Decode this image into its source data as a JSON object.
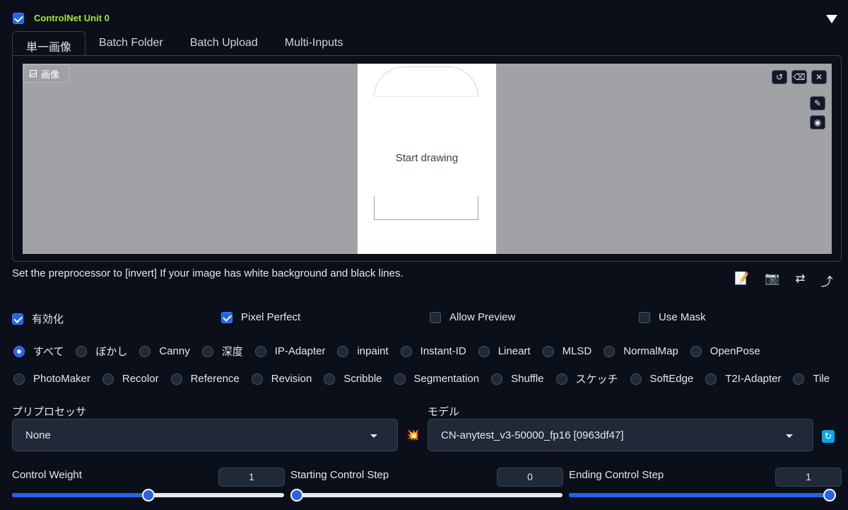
{
  "unit": {
    "title": "ControlNet Unit 0",
    "checked": true
  },
  "tabs": [
    {
      "label": "単一画像",
      "active": true
    },
    {
      "label": "Batch Folder",
      "active": false
    },
    {
      "label": "Batch Upload",
      "active": false
    },
    {
      "label": "Multi-Inputs",
      "active": false
    }
  ],
  "canvas": {
    "image_label": "画像",
    "placeholder": "Start drawing"
  },
  "hint": "Set the preprocessor to [invert] If your image has white background and black lines.",
  "options": {
    "enable": {
      "label": "有効化",
      "checked": true
    },
    "pixel_perfect": {
      "label": "Pixel Perfect",
      "checked": true
    },
    "allow_preview": {
      "label": "Allow Preview",
      "checked": false
    },
    "use_mask": {
      "label": "Use Mask",
      "checked": false
    }
  },
  "control_types": [
    "すべて",
    "ぼかし",
    "Canny",
    "深度",
    "IP-Adapter",
    "inpaint",
    "Instant-ID",
    "Lineart",
    "MLSD",
    "NormalMap",
    "OpenPose",
    "PhotoMaker",
    "Recolor",
    "Reference",
    "Revision",
    "Scribble",
    "Segmentation",
    "Shuffle",
    "スケッチ",
    "SoftEdge",
    "T2I-Adapter",
    "Tile"
  ],
  "selected_control_type": "すべて",
  "preprocessor": {
    "label": "プリプロセッサ",
    "value": "None"
  },
  "model": {
    "label": "モデル",
    "value": "CN-anytest_v3-50000_fp16 [0963df47]"
  },
  "sliders": {
    "weight": {
      "label": "Control Weight",
      "value": "1",
      "fraction": 0.5
    },
    "start": {
      "label": "Starting Control Step",
      "value": "0",
      "fraction": 0.0
    },
    "end": {
      "label": "Ending Control Step",
      "value": "1",
      "fraction": 1.0
    }
  },
  "colors": {
    "accent": "#2563eb",
    "title": "#a3e635",
    "background": "#0b0f19"
  }
}
